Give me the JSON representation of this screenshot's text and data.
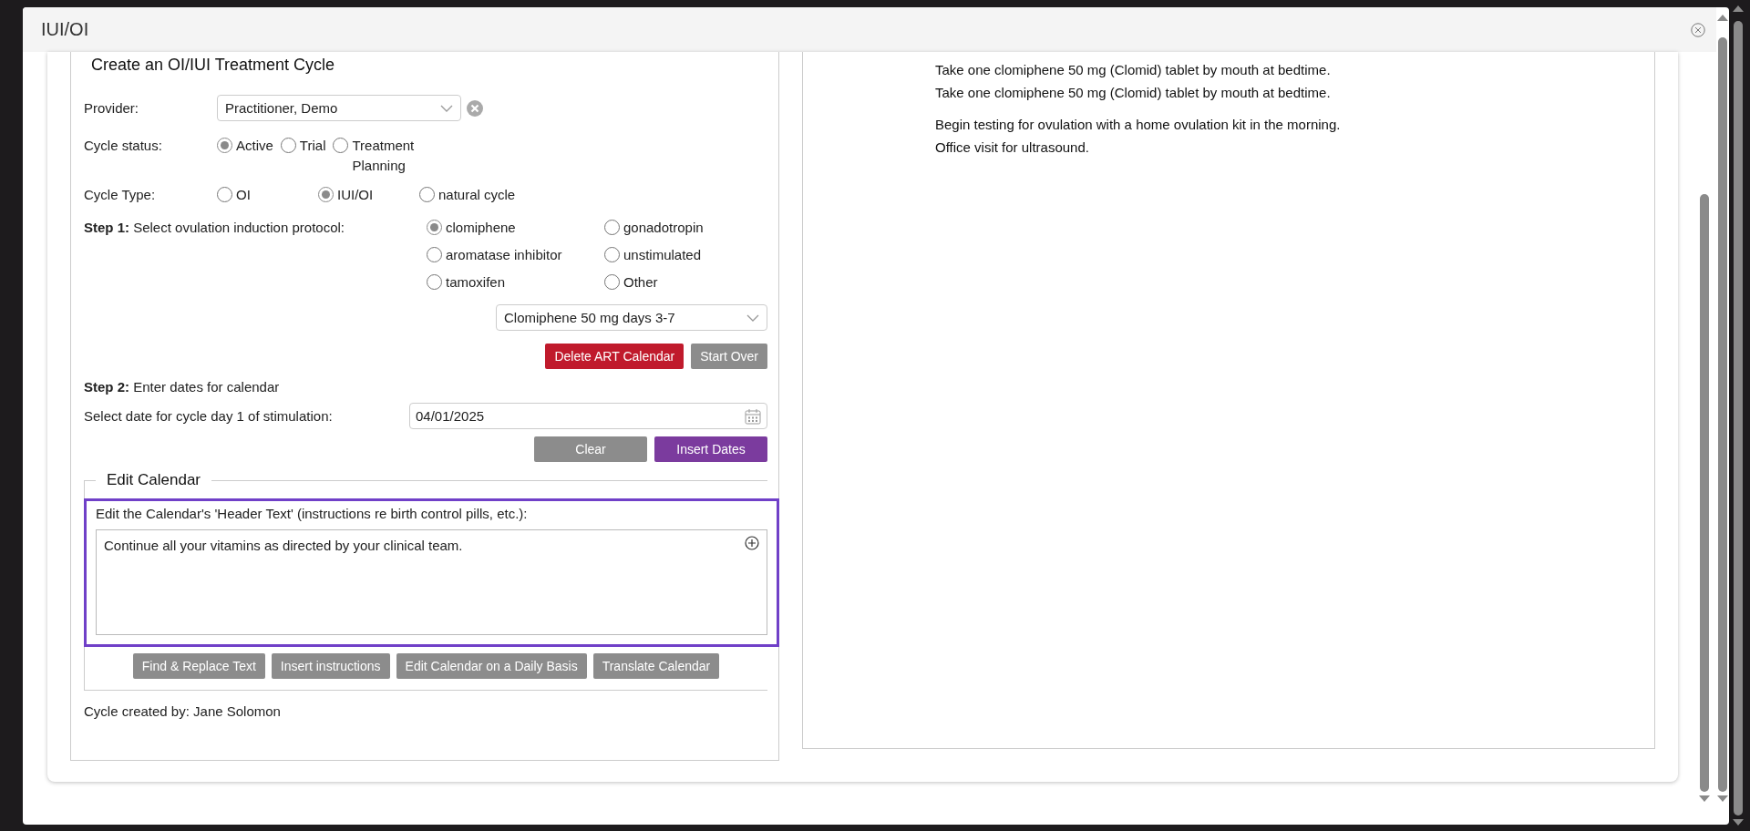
{
  "dialog": {
    "title": "IUI/OI"
  },
  "form": {
    "heading": "Create an OI/IUI Treatment Cycle",
    "provider": {
      "label": "Provider:",
      "value": "Practitioner, Demo"
    },
    "cycle_status": {
      "label": "Cycle status:",
      "options": [
        {
          "label": "Active",
          "selected": true
        },
        {
          "label": "Trial",
          "selected": false
        },
        {
          "label": "Treatment Planning",
          "selected": false
        }
      ]
    },
    "cycle_type": {
      "label": "Cycle Type:",
      "options": [
        {
          "label": "OI",
          "selected": false
        },
        {
          "label": "IUI/OI",
          "selected": true
        },
        {
          "label": "natural cycle",
          "selected": false
        }
      ]
    },
    "step1": {
      "step": "Step 1:",
      "label": "Select ovulation induction protocol:",
      "options": [
        {
          "label": "clomiphene",
          "selected": true
        },
        {
          "label": "gonadotropin",
          "selected": false
        },
        {
          "label": "aromatase inhibitor",
          "selected": false
        },
        {
          "label": "unstimulated",
          "selected": false
        },
        {
          "label": "tamoxifen",
          "selected": false
        },
        {
          "label": "Other",
          "selected": false
        }
      ]
    },
    "protocol": {
      "value": "Clomiphene 50 mg days 3-7"
    },
    "protocol_buttons": [
      {
        "label": "Delete ART Calendar",
        "kind": "danger"
      },
      {
        "label": "Start Over",
        "kind": "secondary"
      }
    ],
    "step2": {
      "step": "Step 2:",
      "label": "Enter dates for calendar"
    },
    "date": {
      "label": "Select date for cycle day 1 of stimulation:",
      "value": "04/01/2025"
    },
    "date_buttons": [
      {
        "label": "Clear",
        "kind": "secondary"
      },
      {
        "label": "Insert Dates",
        "kind": "primary"
      }
    ],
    "edit_calendar": {
      "legend": "Edit Calendar",
      "header_label": "Edit the Calendar's 'Header Text' (instructions re birth control pills, etc.):",
      "header_text": "Continue all your vitamins as directed by your clinical team.",
      "buttons": [
        {
          "label": "Find & Replace Text",
          "kind": "secondary"
        },
        {
          "label": "Insert instructions",
          "kind": "secondary"
        },
        {
          "label": "Edit Calendar on a Daily Basis",
          "kind": "secondary"
        },
        {
          "label": "Translate Calendar",
          "kind": "secondary"
        }
      ]
    },
    "created_by": "Cycle created by: Jane Solomon"
  },
  "preview": {
    "paragraphs": [
      [
        "Take one clomiphene 50 mg (Clomid) tablet by mouth at bedtime.",
        "Take one clomiphene 50 mg (Clomid) tablet by mouth at bedtime."
      ],
      [
        "Begin testing for ovulation with a home ovulation kit in the morning.",
        "Office visit for ultrasound."
      ]
    ]
  }
}
